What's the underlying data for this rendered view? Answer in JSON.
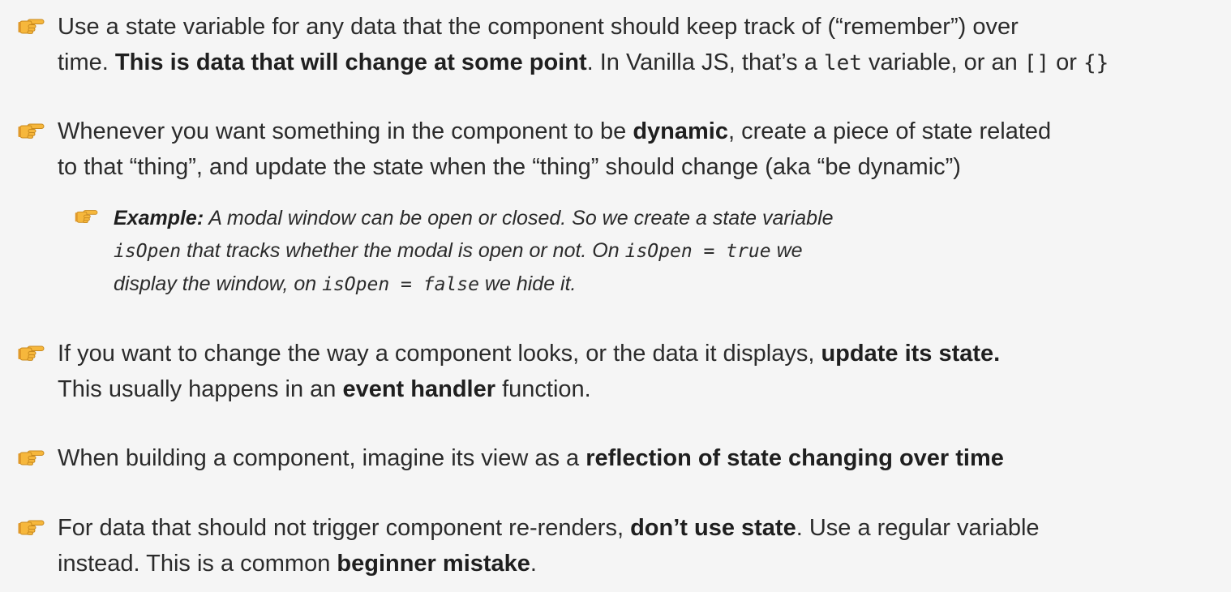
{
  "colors": {
    "background": "#f5f5f5",
    "text": "#2b2b2b",
    "hand_icon": "#f5a623"
  },
  "icon": "backhand-index-pointing-right-icon",
  "bullets": {
    "b1": {
      "l1": "Use a state variable for any data that the component should keep track of (“remember”) over",
      "l2a": "time. ",
      "l2b": "This is data that will change at some point",
      "l2c": ". In Vanilla JS, that’s a ",
      "l2d": "let",
      "l2e": " variable, or an ",
      "l2f": "[]",
      "l2g": " or ",
      "l2h": "{}"
    },
    "b2": {
      "l1a": "Whenever you want something in the component to be ",
      "l1b": "dynamic",
      "l1c": ", create a piece of state related",
      "l2": "to that “thing”, and update the state when the “thing” should change (aka “be dynamic”)"
    },
    "sub1": {
      "l1a": "Example:",
      "l1b": " A modal window can be open or closed. So we create a state variable",
      "l2a": "isOpen",
      "l2b": " that tracks whether the modal is open or not. On ",
      "l2c": "isOpen = true",
      "l2d": " we",
      "l3a": "display the window, on ",
      "l3b": "isOpen = false",
      "l3c": " we hide it."
    },
    "b3": {
      "l1a": "If you want to change the way a component looks, or the data it displays, ",
      "l1b": "update its state.",
      "l2a": "This usually happens in an ",
      "l2b": "event handler",
      "l2c": " function."
    },
    "b4": {
      "l1a": "When building a component, imagine its view as a ",
      "l1b": "reflection of state changing over time"
    },
    "b5": {
      "l1a": "For data that should not trigger component re-renders, ",
      "l1b": "don’t use state",
      "l1c": ". Use a regular variable",
      "l2a": "instead. This is a common ",
      "l2b": "beginner mistake",
      "l2c": "."
    }
  }
}
